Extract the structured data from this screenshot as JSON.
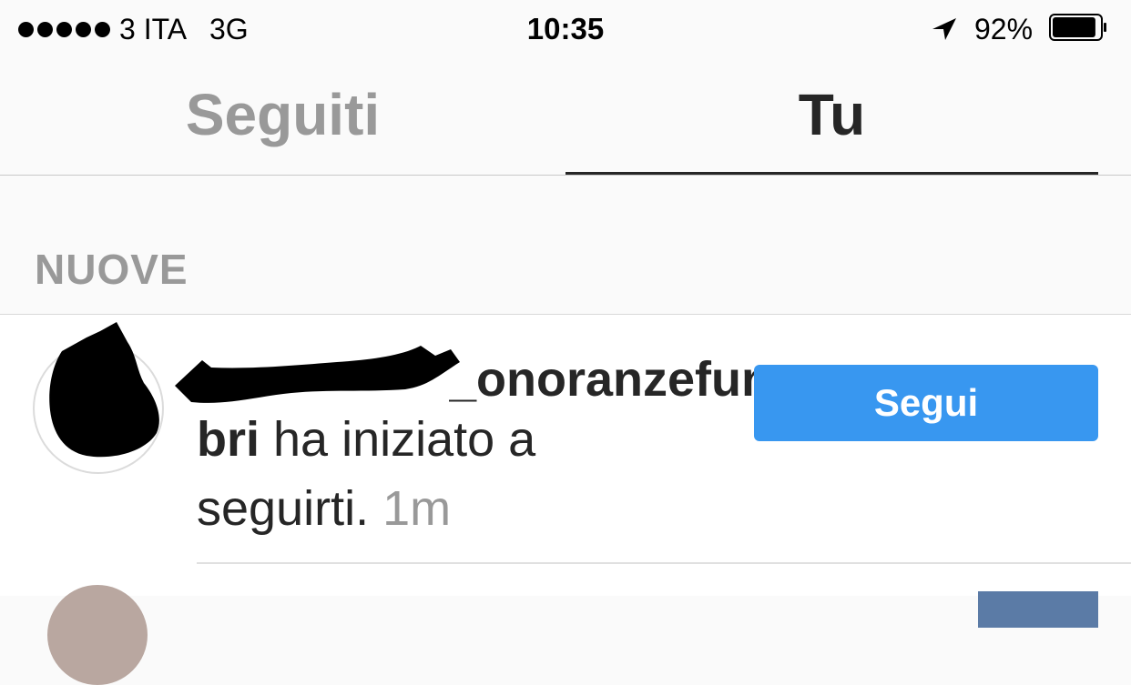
{
  "status_bar": {
    "carrier": "3 ITA   3G",
    "time": "10:35",
    "battery": "92%",
    "battery_level": 0.92,
    "icons": [
      "signal-dots-icon",
      "location-arrow-icon",
      "battery-icon"
    ]
  },
  "tabs": [
    {
      "label": "Seguiti",
      "active": false
    },
    {
      "label": "Tu",
      "active": true
    }
  ],
  "section": {
    "title": "NUOVE"
  },
  "notification": {
    "username_visible": "_onoranzefune",
    "message_bold": "bri",
    "message_rest": " ha iniziato a",
    "message_line2": "seguirti.",
    "time_ago": "1m",
    "follow_button": "Segui"
  },
  "colors": {
    "accent": "#3897f0",
    "text": "#262626",
    "muted": "#999999",
    "background": "#fafafa"
  }
}
